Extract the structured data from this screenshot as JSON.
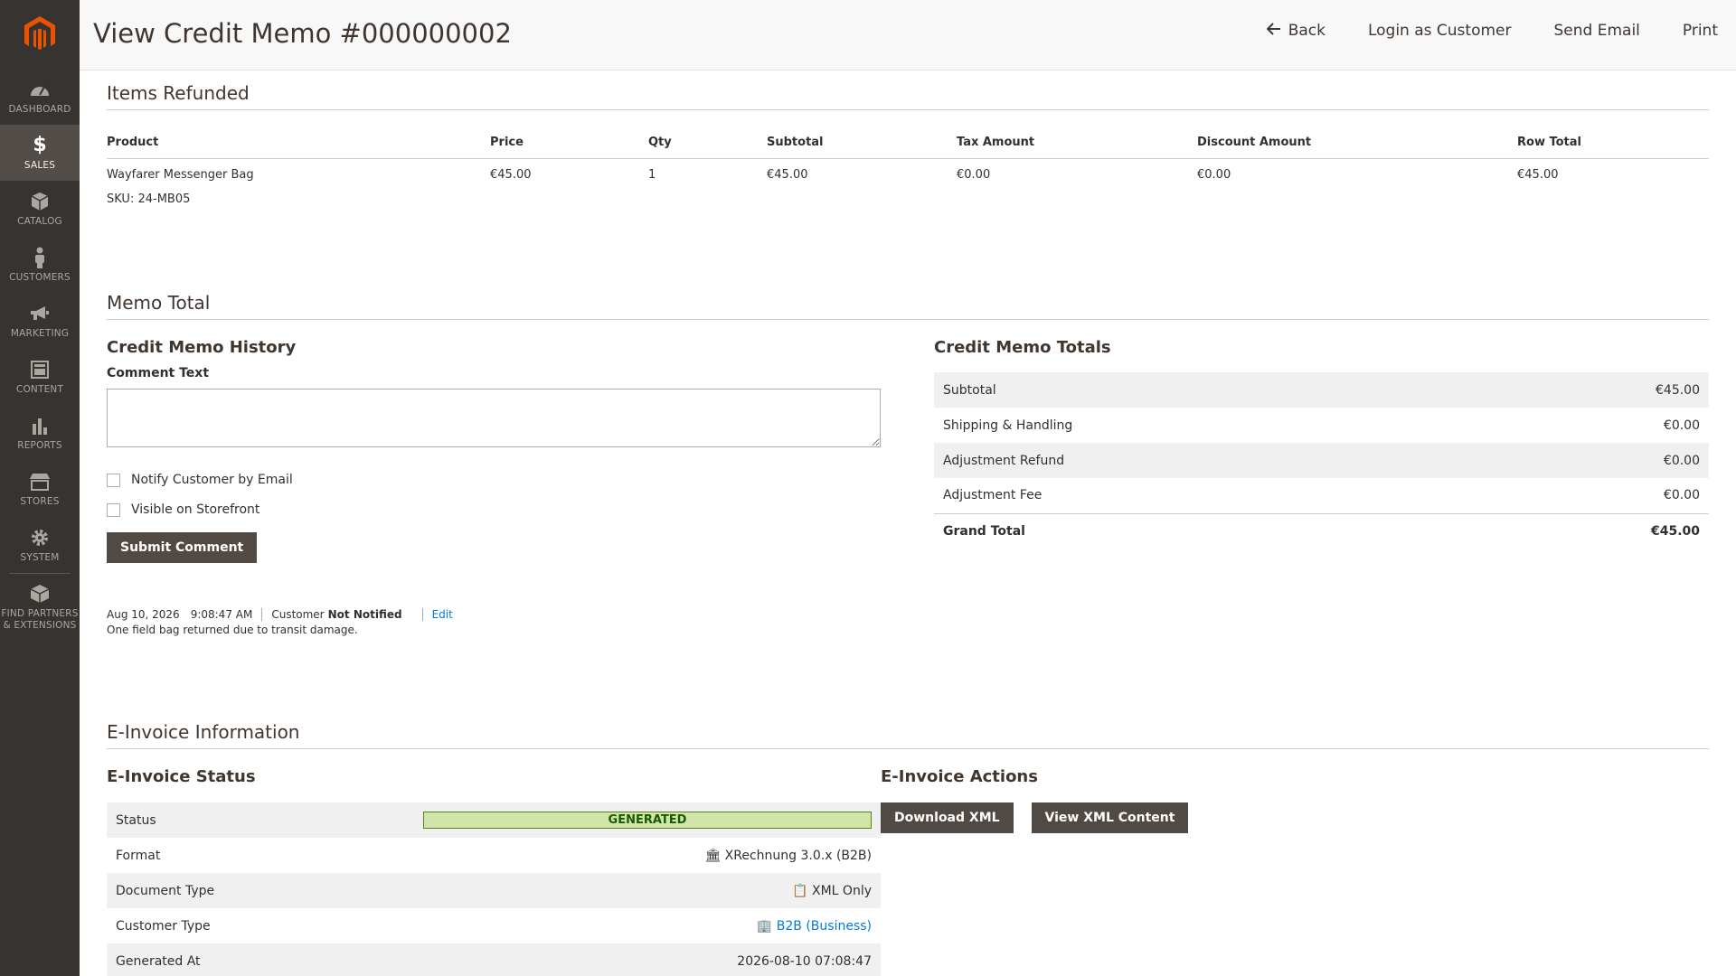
{
  "sidebar": {
    "items": [
      {
        "label": "DASHBOARD",
        "icon": "dashboard-icon"
      },
      {
        "label": "SALES",
        "icon": "dollar-icon"
      },
      {
        "label": "CATALOG",
        "icon": "box-icon"
      },
      {
        "label": "CUSTOMERS",
        "icon": "person-icon"
      },
      {
        "label": "MARKETING",
        "icon": "megaphone-icon"
      },
      {
        "label": "CONTENT",
        "icon": "layout-icon"
      },
      {
        "label": "REPORTS",
        "icon": "bar-chart-icon"
      },
      {
        "label": "STORES",
        "icon": "store-icon"
      },
      {
        "label": "SYSTEM",
        "icon": "gear-icon"
      }
    ],
    "partners": {
      "label1": "FIND PARTNERS",
      "label2": "& EXTENSIONS",
      "icon": "partners-cube-icon"
    }
  },
  "header": {
    "title": "View Credit Memo #000000002",
    "back": "Back",
    "login_as_customer": "Login as Customer",
    "send_email": "Send Email",
    "print": "Print"
  },
  "items_refunded": {
    "title": "Items Refunded",
    "columns": [
      "Product",
      "Price",
      "Qty",
      "Subtotal",
      "Tax Amount",
      "Discount Amount",
      "Row Total"
    ],
    "rows": [
      {
        "product": "Wayfarer Messenger Bag",
        "sku": "SKU: 24-MB05",
        "price": "€45.00",
        "qty": "1",
        "subtotal": "€45.00",
        "tax": "€0.00",
        "discount": "€0.00",
        "row_total": "€45.00"
      }
    ]
  },
  "memo_total": {
    "title": "Memo Total",
    "history": {
      "title": "Credit Memo History",
      "comment_label": "Comment Text",
      "comment_value": "",
      "notify_label": "Notify Customer by Email",
      "visible_label": "Visible on Storefront",
      "submit": "Submit Comment",
      "entry": {
        "date": "Aug 10, 2026",
        "time": "9:08:47 AM",
        "customer_prefix": "Customer",
        "customer_status": "Not Notified",
        "edit": "Edit",
        "text": "One field bag returned due to transit damage."
      }
    },
    "totals": {
      "title": "Credit Memo Totals",
      "rows": [
        {
          "label": "Subtotal",
          "value": "€45.00"
        },
        {
          "label": "Shipping & Handling",
          "value": "€0.00"
        },
        {
          "label": "Adjustment Refund",
          "value": "€0.00"
        },
        {
          "label": "Adjustment Fee",
          "value": "€0.00"
        }
      ],
      "grand": {
        "label": "Grand Total",
        "value": "€45.00"
      }
    }
  },
  "einvoice": {
    "title": "E-Invoice Information",
    "status_title": "E-Invoice Status",
    "rows": {
      "status": {
        "label": "Status",
        "value": "GENERATED"
      },
      "format": {
        "label": "Format",
        "value": "XRechnung 3.0.x (B2B)",
        "icon": "bank-icon"
      },
      "doc_type": {
        "label": "Document Type",
        "value": "XML Only",
        "icon": "clipboard-icon"
      },
      "customer_type": {
        "label": "Customer Type",
        "value": "B2B (Business)",
        "icon": "building-icon"
      },
      "generated_at": {
        "label": "Generated At",
        "value": "2026-08-10 07:08:47"
      }
    },
    "actions_title": "E-Invoice Actions",
    "download_xml": "Download XML",
    "view_xml": "View XML Content"
  },
  "colors": {
    "sidebar": "#373330",
    "active": "#524d49",
    "accent": "#eb5202",
    "button": "#514943",
    "link": "#007bdb"
  }
}
